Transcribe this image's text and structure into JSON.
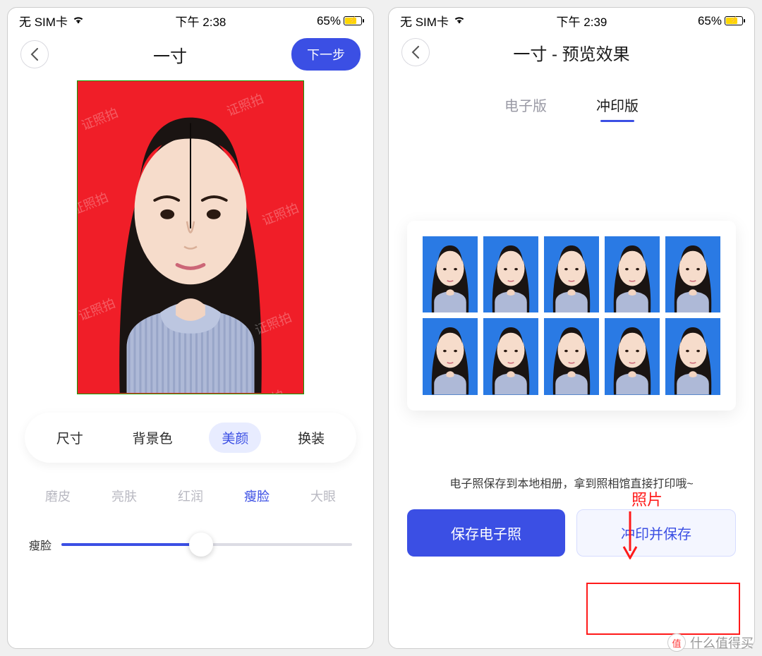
{
  "left": {
    "status": {
      "carrier": "无 SIM卡",
      "time": "下午 2:38",
      "battery": "65%"
    },
    "title": "一寸",
    "next": "下一步",
    "watermark_text": "证照拍",
    "tabs": [
      "尺寸",
      "背景色",
      "美颜",
      "换装"
    ],
    "active_tab_index": 2,
    "subtabs": [
      "磨皮",
      "亮肤",
      "红润",
      "瘦脸",
      "大眼"
    ],
    "active_subtab_index": 3,
    "slider": {
      "label": "瘦脸",
      "value_pct": 48
    },
    "photo_bg": "#f01e28"
  },
  "right": {
    "status": {
      "carrier": "无 SIM卡",
      "time": "下午 2:39",
      "battery": "65%"
    },
    "title": "一寸 - 预览效果",
    "preview_tabs": [
      "电子版",
      "冲印版"
    ],
    "active_preview_index": 1,
    "thumb_bg": "#2a7ae4",
    "thumb_count": 10,
    "hint": "电子照保存到本地相册，拿到照相馆直接打印哦~",
    "annotation": "照片",
    "save_digital": "保存电子照",
    "print_save": "冲印并保存"
  },
  "brand": "什么值得买",
  "brand_badge": "值"
}
